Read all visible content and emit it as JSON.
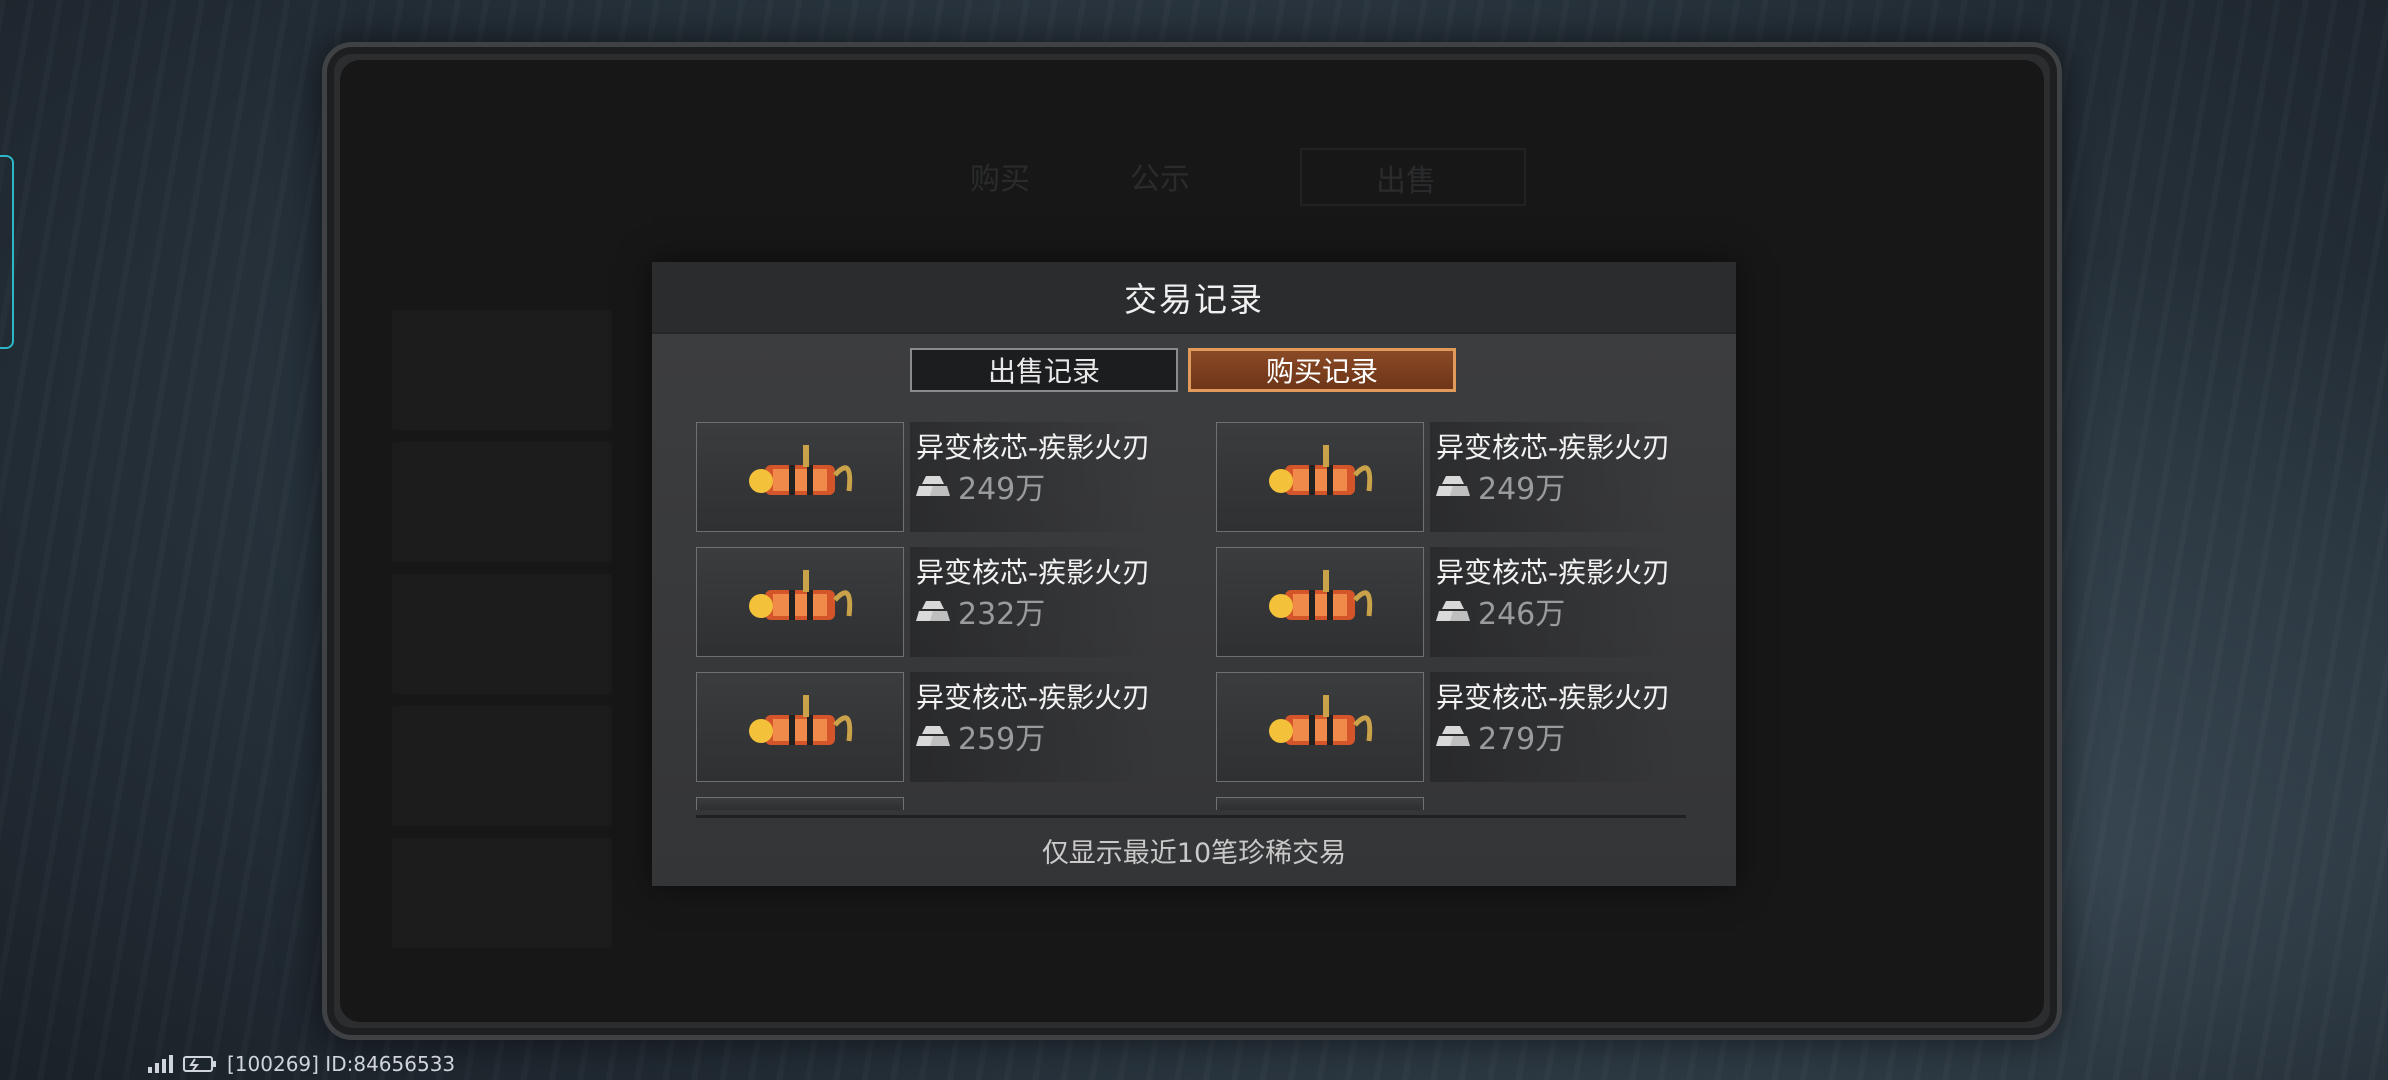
{
  "modal": {
    "title": "交易记录",
    "tabs": [
      {
        "label": "出售记录",
        "active": false
      },
      {
        "label": "购买记录",
        "active": true
      }
    ],
    "items": [
      {
        "name": "异变核芯-疾影火刃",
        "price": "249万"
      },
      {
        "name": "异变核芯-疾影火刃",
        "price": "249万"
      },
      {
        "name": "异变核芯-疾影火刃",
        "price": "232万"
      },
      {
        "name": "异变核芯-疾影火刃",
        "price": "246万"
      },
      {
        "name": "异变核芯-疾影火刃",
        "price": "259万"
      },
      {
        "name": "异变核芯-疾影火刃",
        "price": "279万"
      }
    ],
    "footer_note": "仅显示最近10笔珍稀交易"
  },
  "background": {
    "tabs": [
      "购买",
      "公示",
      "出售"
    ]
  },
  "status_bar": {
    "text": "[100269] ID:84656533"
  },
  "icons": {
    "currency": "gold-bar-icon",
    "item": "weapon-core-icon",
    "signal": "signal-icon",
    "battery": "battery-icon"
  },
  "colors": {
    "active_tab": "#7a3d1f",
    "active_tab_border": "#e29a5a",
    "modal_bg": "#3a3b3d"
  }
}
